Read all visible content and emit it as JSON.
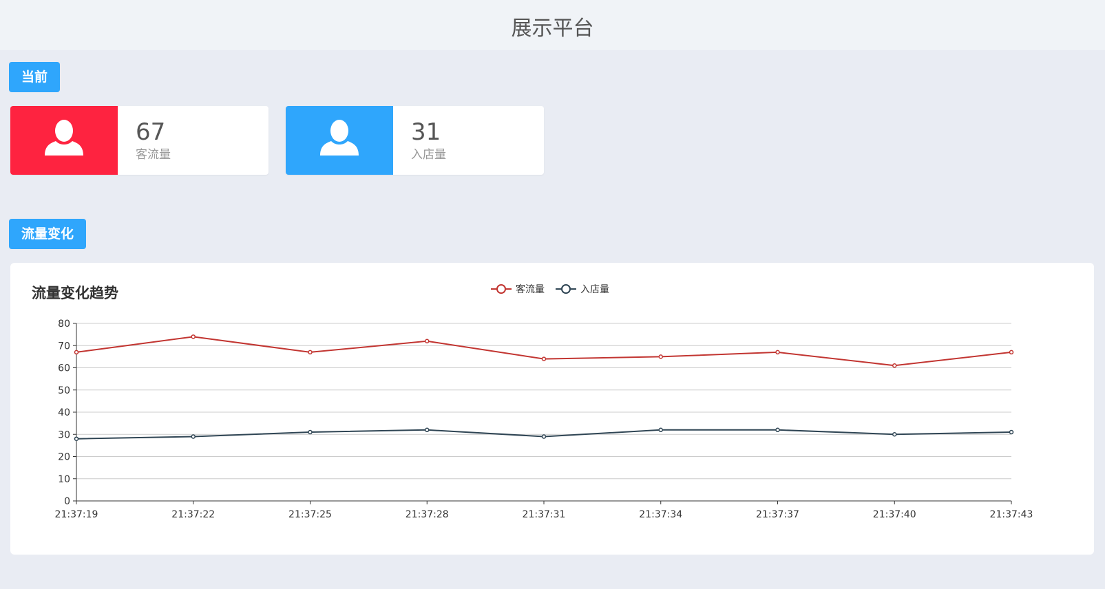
{
  "header": {
    "title": "展示平台"
  },
  "current_section": {
    "badge_label": "当前"
  },
  "stats": [
    {
      "value": "67",
      "label": "客流量",
      "color": "#fe2340",
      "icon": "user-icon"
    },
    {
      "value": "31",
      "label": "入店量",
      "color": "#2fa6fc",
      "icon": "user-icon"
    }
  ],
  "trend_section": {
    "badge_label": "流量变化"
  },
  "chart_data": {
    "type": "line",
    "title": "流量变化趋势",
    "x": [
      "21:37:19",
      "21:37:22",
      "21:37:25",
      "21:37:28",
      "21:37:31",
      "21:37:34",
      "21:37:37",
      "21:37:40",
      "21:37:43"
    ],
    "series": [
      {
        "name": "客流量",
        "color": "#c23531",
        "values": [
          67,
          74,
          67,
          72,
          64,
          65,
          67,
          61,
          67
        ]
      },
      {
        "name": "入店量",
        "color": "#2f4554",
        "values": [
          28,
          29,
          31,
          32,
          29,
          32,
          32,
          30,
          31
        ]
      }
    ],
    "ylim": [
      0,
      80
    ],
    "yticks": [
      0,
      10,
      20,
      30,
      40,
      50,
      60,
      70,
      80
    ],
    "grid": true,
    "legend": "top-center"
  }
}
